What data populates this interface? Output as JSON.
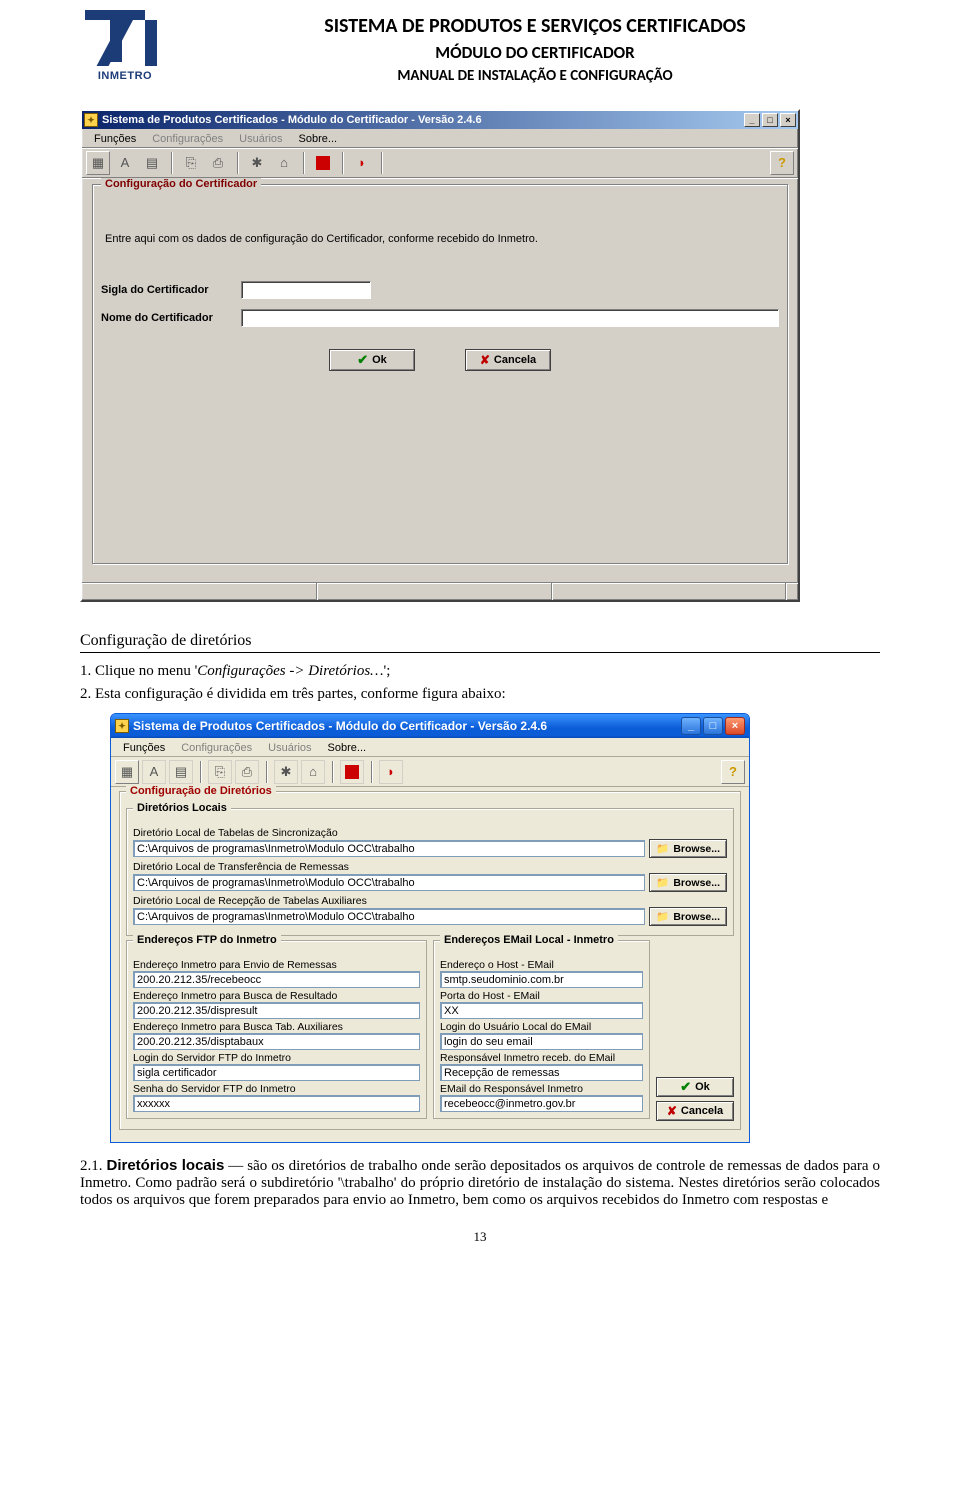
{
  "header": {
    "title1": "SISTEMA DE PRODUTOS E SERVIÇOS CERTIFICADOS",
    "title2": "MÓDULO DO CERTIFICADOR",
    "title3": "MANUAL DE INSTALAÇÃO E CONFIGURAÇÃO",
    "logo_label": "INMETRO"
  },
  "win1": {
    "title": "Sistema de Produtos Certificados - Módulo do Certificador - Versão 2.4.6",
    "menu": {
      "funcoes": "Funções",
      "config": "Configurações",
      "usuarios": "Usuários",
      "sobre": "Sobre..."
    },
    "group_title": "Configuração do Certificador",
    "instructions": "Entre aqui com os dados de configuração do Certificador, conforme recebido do Inmetro.",
    "lbl_sigla": "Sigla do Certificador",
    "lbl_nome": "Nome do Certificador",
    "val_sigla": "",
    "val_nome": "",
    "btn_ok": "Ok",
    "btn_cancel": "Cancela"
  },
  "section": {
    "heading": "Configuração de diretórios",
    "step1_prefix": "1.   Clique no menu ",
    "step1_em": "Configurações -> Diretórios…",
    "step1_suffix": ";",
    "step2": "2.   Esta configuração é dividida em três partes, conforme figura abaixo:"
  },
  "win2": {
    "title": "Sistema de Produtos Certificados - Módulo do Certificador - Versão 2.4.6",
    "menu": {
      "funcoes": "Funções",
      "config": "Configurações",
      "usuarios": "Usuários",
      "sobre": "Sobre..."
    },
    "group_main": "Configuração de Diretórios",
    "group_local": "Diretórios Locais",
    "local": {
      "l1": "Diretório Local de Tabelas de Sincronização",
      "v1": "C:\\Arquivos de programas\\Inmetro\\Modulo OCC\\trabalho",
      "l2": "Diretório Local de Transferência de Remessas",
      "v2": "C:\\Arquivos de programas\\Inmetro\\Modulo OCC\\trabalho",
      "l3": "Diretório Local de Recepção de Tabelas Auxiliares",
      "v3": "C:\\Arquivos de programas\\Inmetro\\Modulo OCC\\trabalho",
      "browse": "Browse..."
    },
    "group_ftp": "Endereços FTP do Inmetro",
    "ftp": {
      "l1": "Endereço Inmetro para Envio de Remessas",
      "v1": "200.20.212.35/recebeocc",
      "l2": "Endereço Inmetro para Busca de Resultado",
      "v2": "200.20.212.35/dispresult",
      "l3": "Endereço Inmetro para Busca Tab. Auxiliares",
      "v3": "200.20.212.35/disptabaux",
      "l4": "Login do Servidor FTP do Inmetro",
      "v4": "sigla certificador",
      "l5": "Senha do Servidor FTP do Inmetro",
      "v5": "xxxxxx"
    },
    "group_mail": "Endereços EMail Local - Inmetro",
    "mail": {
      "l1": "Endereço o Host - EMail",
      "v1": "smtp.seudominio.com.br",
      "l2": "Porta do Host - EMail",
      "v2": "XX",
      "l3": "Login do Usuário Local do EMail",
      "v3": "login do seu email",
      "l4": "Responsável Inmetro receb. do EMail",
      "v4": "Recepção de remessas",
      "l5": "EMail do Responsável Inmetro",
      "v5": "recebeocc@inmetro.gov.br"
    },
    "btn_ok": "Ok",
    "btn_cancel": "Cancela"
  },
  "para21": {
    "num": "2.1. ",
    "bold": "Diretórios locais",
    "rest": " — são os diretórios de trabalho onde serão depositados os arquivos de controle de remessas de dados para o Inmetro. Como padrão será o subdiretório '\\trabalho' do próprio diretório de instalação do sistema. Nestes diretórios serão colocados todos os arquivos que forem preparados para envio ao Inmetro, bem como os arquivos recebidos do Inmetro com respostas e"
  },
  "page_number": "13"
}
